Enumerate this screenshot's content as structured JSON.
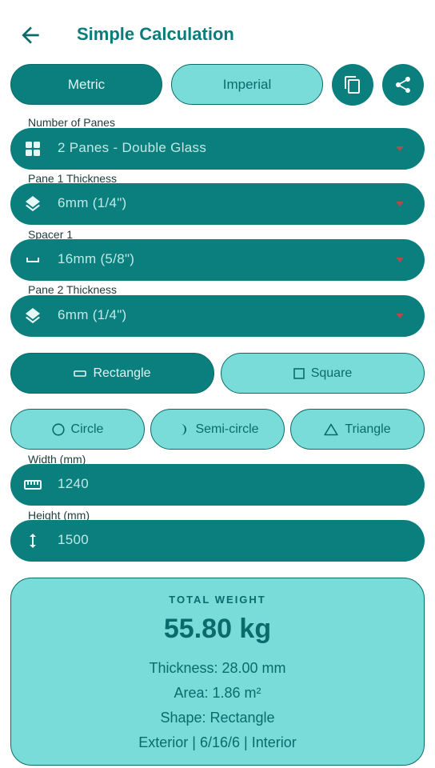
{
  "header": {
    "title": "Simple Calculation",
    "back_icon": "arrow-left-icon"
  },
  "units": {
    "metric_label": "Metric",
    "imperial_label": "Imperial",
    "selected": "Metric"
  },
  "actions": {
    "copy_icon": "copy-icon",
    "share_icon": "share-icon"
  },
  "fields": {
    "panes": {
      "label": "Number of Panes",
      "value": "2 Panes - Double Glass",
      "icon": "grid-icon"
    },
    "pane1": {
      "label": "Pane 1 Thickness",
      "value": "6mm (1/4\")",
      "icon": "layers-icon"
    },
    "spacer1": {
      "label": "Spacer 1",
      "value": "16mm (5/8\")",
      "icon": "space-bar-icon"
    },
    "pane2": {
      "label": "Pane 2 Thickness",
      "value": "6mm (1/4\")",
      "icon": "layers-icon"
    },
    "width": {
      "label": "Width (mm)",
      "value": "1240",
      "icon": "ruler-icon"
    },
    "height": {
      "label": "Height (mm)",
      "value": "1500",
      "icon": "vertical-arrows-icon"
    }
  },
  "shapes": {
    "rectangle": "Rectangle",
    "square": "Square",
    "circle": "Circle",
    "semicircle": "Semi-circle",
    "triangle": "Triangle",
    "selected": "Rectangle"
  },
  "result": {
    "label": "TOTAL WEIGHT",
    "weight": "55.80 kg",
    "thickness": "Thickness: 28.00 mm",
    "area": "Area: 1.86 m²",
    "shape": "Shape: Rectangle",
    "composition": "Exterior | 6/16/6 | Interior"
  },
  "colors": {
    "primary": "#0b7f7d",
    "light": "#7adcd8",
    "text": "#0b6b6b",
    "caret": "#b24b4b"
  }
}
